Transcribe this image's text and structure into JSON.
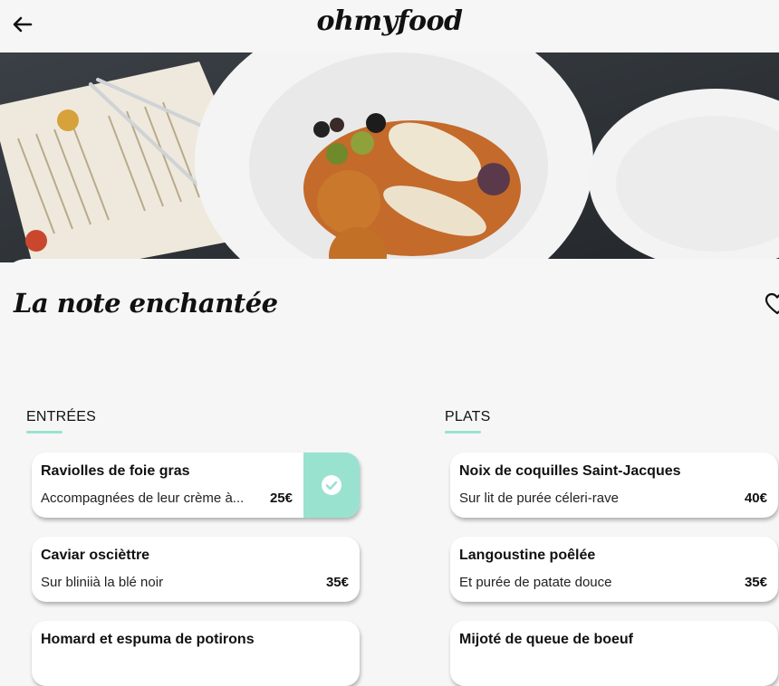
{
  "header": {
    "logo": "ohmyfood"
  },
  "restaurant": {
    "name": "La note enchantée"
  },
  "sections": [
    {
      "title": "ENTRÉES",
      "items": [
        {
          "name": "Raviolles de foie gras",
          "description": "Accompagnées de leur crème à...",
          "price": "25€",
          "selected": true
        },
        {
          "name": "Caviar oscièttre",
          "description": "Sur bliniià la blé noir",
          "price": "35€"
        },
        {
          "name": "Homard et espuma de potirons"
        }
      ]
    },
    {
      "title": "PLATS",
      "items": [
        {
          "name": "Noix de coquilles Saint-Jacques",
          "description": "Sur lit de purée céleri-rave",
          "price": "40€"
        },
        {
          "name": "Langoustine poêlée",
          "description": "Et purée de patate douce",
          "price": "35€"
        },
        {
          "name": "Mijoté de queue de boeuf"
        }
      ]
    }
  ],
  "colors": {
    "accent": "#99e2d0",
    "background": "#f6f6f6"
  }
}
